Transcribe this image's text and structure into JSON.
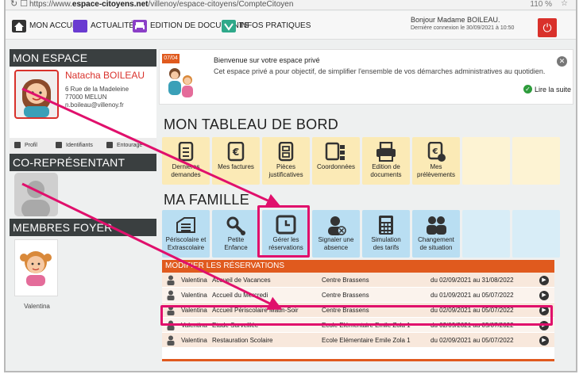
{
  "browser": {
    "url_prefix": "https://www.",
    "url_domain": "espace-citoyens.net",
    "url_path": "/villenoy/espace-citoyens/CompteCitoyen",
    "zoom": "110 %"
  },
  "topnav": {
    "items": [
      {
        "label": "MON ACCUEIL",
        "icon": "home-icon"
      },
      {
        "label": "ACTUALITÉS",
        "icon": "news-icon"
      },
      {
        "label": "EDITION DE DOCUMENTS",
        "icon": "printer-icon"
      },
      {
        "label": "INFOS PRATIQUES",
        "icon": "info-icon"
      }
    ],
    "greeting": "Bonjour Madame BOILEAU.",
    "last_login": "Dernière connexion le 30/09/2021 à 10:50"
  },
  "sidebar": {
    "mon_espace_title": "MON ESPACE",
    "profile": {
      "name": "Natacha BOILEAU",
      "address_line1": "6 Rue de la Madeleine",
      "address_line2": "77000 MELUN",
      "email": "n.boileau@villenoy.fr"
    },
    "tools": [
      "Profil",
      "Identifiants",
      "Entourage"
    ],
    "corep_title": "CO-REPRÉSENTANT",
    "members_title": "MEMBRES FOYER",
    "members": [
      {
        "name": "Valentina"
      }
    ]
  },
  "welcome": {
    "date_badge": "07/04",
    "title": "Bienvenue sur votre espace privé",
    "text": "Cet espace privé a pour objectif, de simplifier l'ensemble de vos démarches administratives au quotidien.",
    "read_more": "Lire la suite"
  },
  "dashboard": {
    "title": "MON TABLEAU DE BORD",
    "tiles": [
      {
        "line1": "Dernières",
        "line2": "demandes"
      },
      {
        "line1": "Mes factures",
        "line2": ""
      },
      {
        "line1": "Pièces",
        "line2": "justificatives"
      },
      {
        "line1": "Coordonnées",
        "line2": ""
      },
      {
        "line1": "Edition de",
        "line2": "documents"
      },
      {
        "line1": "Mes",
        "line2": "prélèvements"
      }
    ]
  },
  "family": {
    "title": "MA FAMILLE",
    "tiles": [
      {
        "line1": "Périscolaire et",
        "line2": "Extrascolaire"
      },
      {
        "line1": "Petite",
        "line2": "Enfance"
      },
      {
        "line1": "Gérer les",
        "line2": "réservations"
      },
      {
        "line1": "Signaler une",
        "line2": "absence"
      },
      {
        "line1": "Simulation",
        "line2": "des tarifs"
      },
      {
        "line1": "Changement",
        "line2": "de situation"
      }
    ]
  },
  "reservations": {
    "header": "MODIFIER LES RÉSERVATIONS",
    "rows": [
      {
        "child": "Valentina",
        "activity": "Accueil de Vacances",
        "place": "Centre Brassens",
        "period": "du 02/09/2021 au 31/08/2022"
      },
      {
        "child": "Valentina",
        "activity": "Accueil du Mercredi",
        "place": "Centre Brassens",
        "period": "du 01/09/2021 au 05/07/2022"
      },
      {
        "child": "Valentina",
        "activity": "Accueil Périscolaire Matin-Soir",
        "place": "Centre Brassens",
        "period": "du 02/09/2021 au 05/07/2022"
      },
      {
        "child": "Valentina",
        "activity": "Etude Surveillée",
        "place": "Ecole Elémentaire Emile Zola 1",
        "period": "du 02/09/2021 au 05/07/2022"
      },
      {
        "child": "Valentina",
        "activity": "Restauration Scolaire",
        "place": "Ecole Elémentaire Emile Zola 1",
        "period": "du 02/09/2021 au 05/07/2022"
      }
    ]
  },
  "colors": {
    "accent": "#e05a1e",
    "highlight": "#e0106c",
    "power": "#d9312b",
    "dashboard_tile": "#fbeab6",
    "family_tile": "#b9def2"
  }
}
